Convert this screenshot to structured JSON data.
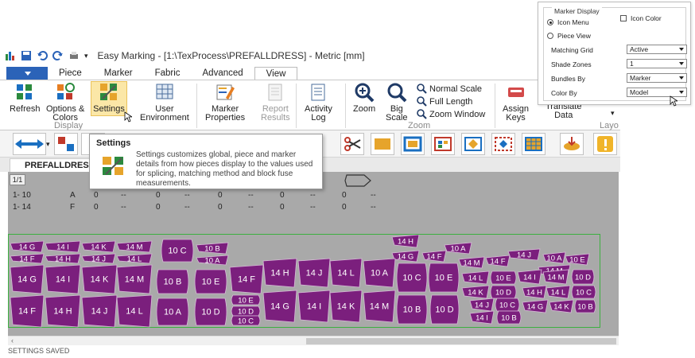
{
  "window": {
    "title": "Easy Marking - [1:\\TexProcess\\PREFALLDRESS] - Metric [mm]"
  },
  "tabs": [
    "Piece",
    "Marker",
    "Fabric",
    "Advanced",
    "View"
  ],
  "active_tab": "View",
  "ribbon": {
    "refresh": "Refresh",
    "options_colors_1": "Options &",
    "options_colors_2": "Colors",
    "settings": "Settings",
    "user_env_1": "User",
    "user_env_2": "Environment",
    "marker_props_1": "Marker",
    "marker_props_2": "Properties",
    "report_results_1": "Report",
    "report_results_2": "Results",
    "activity_log_1": "Activity",
    "activity_log_2": "Log",
    "zoom": "Zoom",
    "big_scale_1": "Big",
    "big_scale_2": "Scale",
    "normal_scale": "Normal Scale",
    "full_length": "Full Length",
    "zoom_window": "Zoom Window",
    "assign_keys_1": "Assign",
    "assign_keys_2": "Keys",
    "translate_data_1": "Translate",
    "translate_data_2": "Data",
    "group_display": "Display",
    "group_zoom": "Zoom",
    "group_layout": "Layo"
  },
  "tooltip": {
    "title": "Settings",
    "body": "Settings customizes global, piece and marker details from how pieces display to the values used for splicing, matching method and block fuse measurements."
  },
  "document_tab": "PREFALLDRESS",
  "canvas": {
    "page_indicator": "1/1",
    "rows": [
      {
        "label": "1- 10",
        "letter": "A",
        "cells": [
          "0",
          "--",
          "0",
          "--",
          "0",
          "--",
          "0",
          "--",
          "0",
          "--"
        ]
      },
      {
        "label": "1- 14",
        "letter": "F",
        "cells": [
          "0",
          "--",
          "0",
          "--",
          "0",
          "--",
          "0",
          "--",
          "0",
          "--"
        ]
      }
    ],
    "pieces_row1": [
      "14 G",
      "14 I",
      "14 K",
      "14 M",
      "10 C",
      "10 B",
      "14 H",
      "14 G",
      "14 F",
      "10 A",
      "14 M",
      "14 F",
      "14 J",
      "10 A",
      "10 E"
    ],
    "pieces_row1b": [
      "14 F",
      "14 H",
      "14 J",
      "14 L",
      "10 A",
      "14 M"
    ],
    "pieces_row2": [
      "14 G",
      "14 I",
      "14 K",
      "14 M",
      "10 B",
      "10 E",
      "14 F",
      "14 H",
      "14 J",
      "14 L",
      "10 A",
      "10 C",
      "10 E",
      "14 L",
      "10 E",
      "14 I",
      "14 M",
      "10 D"
    ],
    "pieces_row3": [
      "14 F",
      "14 H",
      "14 J",
      "14 L",
      "10 A",
      "10 D",
      "10 E",
      "10 D",
      "10 C",
      "14 G",
      "14 I",
      "14 K",
      "14 M",
      "10 B",
      "10 D",
      "14 K",
      "10 D",
      "14 J",
      "10 C",
      "14 I",
      "10 B",
      "14 H",
      "14 L",
      "10 C",
      "14 G",
      "14 K",
      "10 B"
    ]
  },
  "status_text": "SETTINGS SAVED",
  "marker_display": {
    "legend": "Marker Display",
    "icon_menu": "Icon Menu",
    "piece_view": "Piece View",
    "icon_color": "Icon Color",
    "matching_grid_label": "Matching Grid",
    "matching_grid_value": "Active",
    "shade_zones_label": "Shade Zones",
    "shade_zones_value": "1",
    "bundles_by_label": "Bundles By",
    "bundles_by_value": "Marker",
    "color_by_label": "Color By",
    "color_by_value": "Model"
  },
  "colors": {
    "piece_fill": "#7b1f7d",
    "piece_stroke": "#d8b8d8",
    "canvas_bg": "#a9a9a9",
    "accent_blue": "#2b63b8",
    "hover_yellow": "#fbe7a7"
  }
}
